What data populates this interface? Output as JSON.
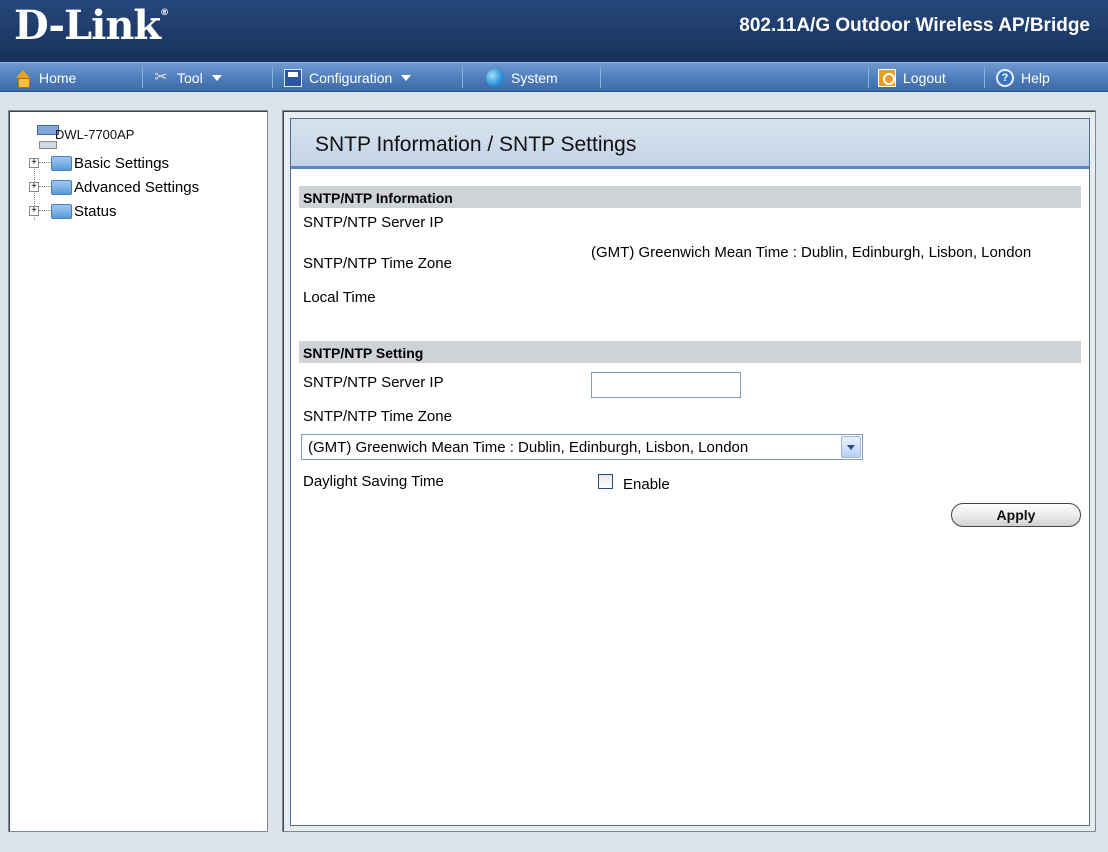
{
  "header": {
    "logo": "D-Link",
    "logo_mark": "®",
    "product": "802.11A/G Outdoor Wireless AP/Bridge"
  },
  "toolbar": {
    "home": "Home",
    "tool": "Tool",
    "configuration": "Configuration",
    "system": "System",
    "logout": "Logout",
    "help": "Help",
    "icons": [
      "home-icon",
      "tool-icon",
      "save-icon",
      "system-icon",
      "logout-icon",
      "help-icon"
    ]
  },
  "tree": {
    "root": "DWL-7700AP",
    "items": [
      {
        "label": "Basic Settings"
      },
      {
        "label": "Advanced Settings"
      },
      {
        "label": "Status"
      }
    ]
  },
  "main": {
    "title": "SNTP Information / SNTP Settings",
    "info_section": "SNTP/NTP Information",
    "info": {
      "server_ip_label": "SNTP/NTP Server IP",
      "server_ip_value": "",
      "time_zone_label": "SNTP/NTP Time Zone",
      "time_zone_value": "(GMT) Greenwich Mean Time : Dublin, Edinburgh, Lisbon, London",
      "local_time_label": "Local Time",
      "local_time_value": ""
    },
    "setting_section": "SNTP/NTP Setting",
    "setting": {
      "server_ip_label": "SNTP/NTP Server IP",
      "server_ip_value": "",
      "time_zone_label": "SNTP/NTP Time Zone",
      "time_zone_selected": "(GMT) Greenwich Mean Time : Dublin, Edinburgh, Lisbon, London",
      "dst_label": "Daylight Saving Time",
      "dst_enable_label": "Enable",
      "dst_enabled": false,
      "apply_label": "Apply"
    }
  },
  "colors": {
    "header_bg": "#1d3a68",
    "toolbar_bg": "#4d7cbb",
    "title_bar_bg": "#c3d3e6",
    "section_bg": "#cfd2d6"
  }
}
